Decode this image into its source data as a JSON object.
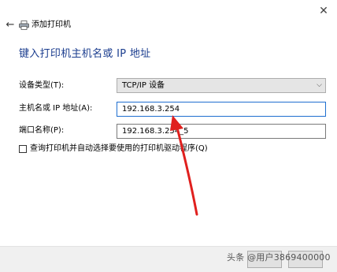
{
  "window": {
    "close_glyph": "✕",
    "back_glyph": "←"
  },
  "header": {
    "title": "添加打印机"
  },
  "main": {
    "heading": "键入打印机主机名或 IP 地址"
  },
  "form": {
    "device_type_label": "设备类型(T):",
    "device_type_value": "TCP/IP 设备",
    "hostname_label": "主机名或 IP 地址(A):",
    "hostname_value": "192.168.3.254",
    "port_label": "端口名称(P):",
    "port_value": "192.168.3.254_5",
    "query_checkbox_label": "查询打印机并自动选择要使用的打印机驱动程序(Q)",
    "query_checked": false
  },
  "footer": {
    "watermark": "头条 @用户3869400000"
  },
  "icons": {
    "back": "back-arrow-icon",
    "printer": "printer-icon",
    "close": "close-icon",
    "dropdown": "chevron-down-icon",
    "annotation": "red-arrow-annotation"
  },
  "colors": {
    "heading": "#1a3c8e",
    "focus_border": "#1f6fd0",
    "annotation": "#e0201e",
    "footer_bg": "#f0f0f0"
  }
}
